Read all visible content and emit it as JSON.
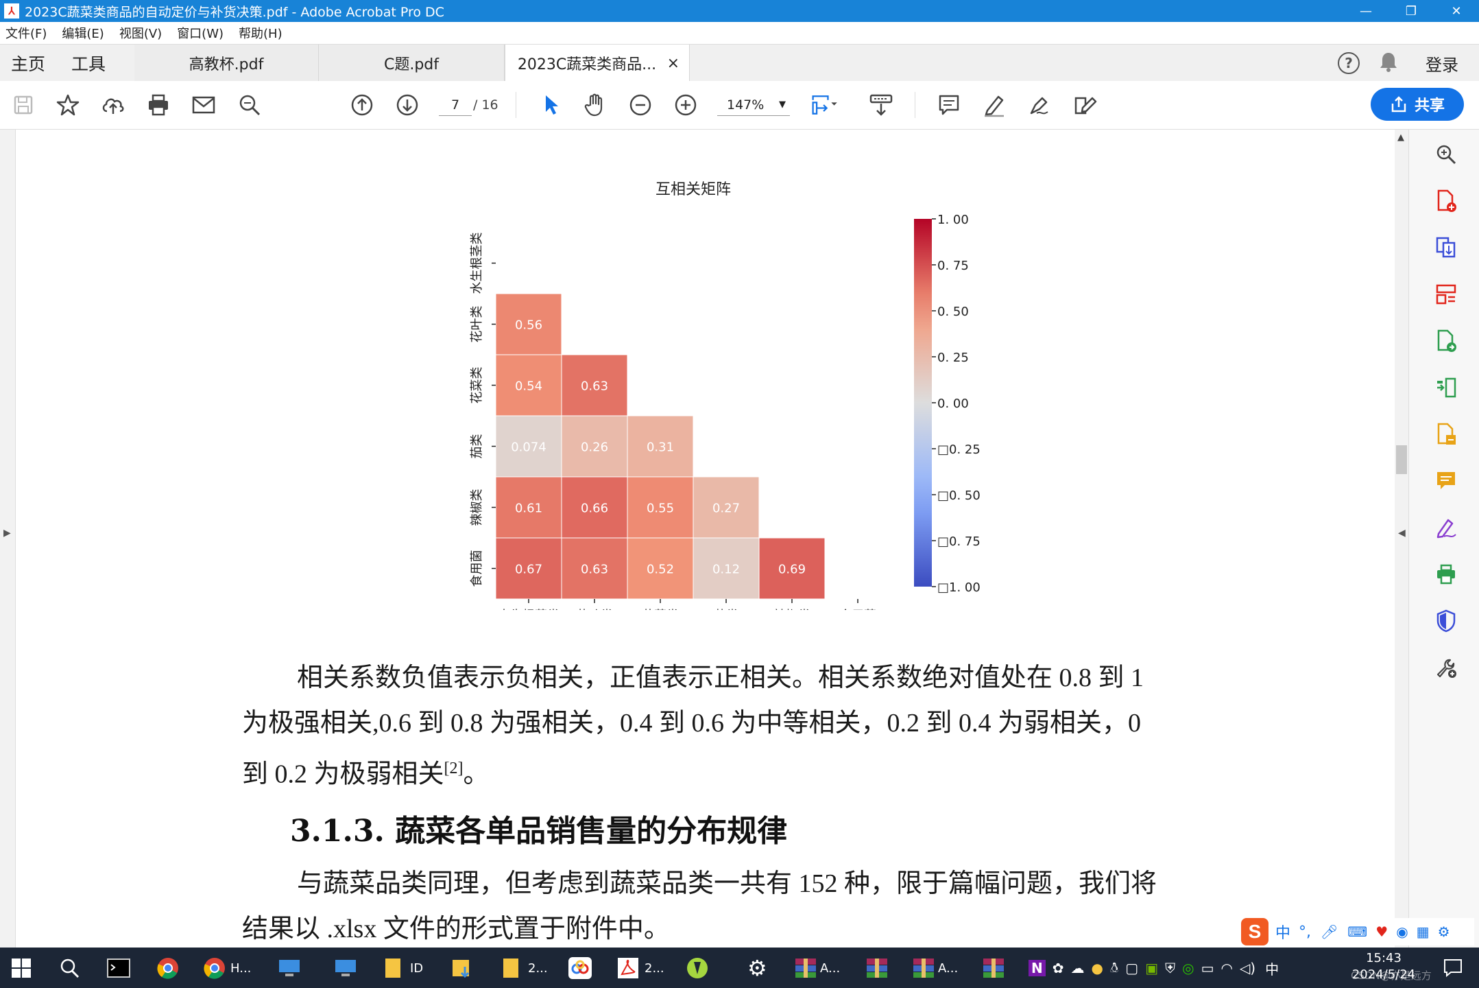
{
  "window": {
    "title": "2023C蔬菜类商品的自动定价与补货决策.pdf - Adobe Acrobat Pro DC",
    "minimize": "—",
    "restore": "❐",
    "close": "✕"
  },
  "menu": [
    "文件(F)",
    "编辑(E)",
    "视图(V)",
    "窗口(W)",
    "帮助(H)"
  ],
  "nav": {
    "home": "主页",
    "tools": "工具"
  },
  "tabs": [
    {
      "label": "高教杯.pdf"
    },
    {
      "label": "C题.pdf"
    },
    {
      "label": "2023C蔬菜类商品...",
      "close": "×"
    }
  ],
  "header_right": {
    "help": "?",
    "login": "登录"
  },
  "toolbar": {
    "page_current": "7",
    "page_total": "/ 16",
    "zoom": "147%",
    "share_label": "共享"
  },
  "chart_data": {
    "type": "heatmap",
    "title": "互相关矩阵",
    "rows": [
      "水生根茎类",
      "花叶类",
      "花菜类",
      "茄类",
      "辣椒类",
      "食用菌"
    ],
    "columns": [
      "水生根茎类",
      "花叶类",
      "花菜类",
      "茄类",
      "辣椒类",
      "食用菌"
    ],
    "mask": "upper-triangle-including-diagonal",
    "cells": [
      {
        "row": 1,
        "col": 0,
        "value": 0.56,
        "label": "0.56"
      },
      {
        "row": 2,
        "col": 0,
        "value": 0.54,
        "label": "0.54"
      },
      {
        "row": 2,
        "col": 1,
        "value": 0.63,
        "label": "0.63"
      },
      {
        "row": 3,
        "col": 0,
        "value": 0.074,
        "label": "0.074"
      },
      {
        "row": 3,
        "col": 1,
        "value": 0.26,
        "label": "0.26"
      },
      {
        "row": 3,
        "col": 2,
        "value": 0.31,
        "label": "0.31"
      },
      {
        "row": 4,
        "col": 0,
        "value": 0.61,
        "label": "0.61"
      },
      {
        "row": 4,
        "col": 1,
        "value": 0.66,
        "label": "0.66"
      },
      {
        "row": 4,
        "col": 2,
        "value": 0.55,
        "label": "0.55"
      },
      {
        "row": 4,
        "col": 3,
        "value": 0.27,
        "label": "0.27"
      },
      {
        "row": 5,
        "col": 0,
        "value": 0.67,
        "label": "0.67"
      },
      {
        "row": 5,
        "col": 1,
        "value": 0.63,
        "label": "0.63"
      },
      {
        "row": 5,
        "col": 2,
        "value": 0.52,
        "label": "0.52"
      },
      {
        "row": 5,
        "col": 3,
        "value": 0.12,
        "label": "0.12"
      },
      {
        "row": 5,
        "col": 4,
        "value": 0.69,
        "label": "0.69"
      }
    ],
    "colorbar": {
      "range": [
        -1.0,
        1.0
      ],
      "colormap": "coolwarm",
      "ticks": [
        1.0,
        0.75,
        0.5,
        0.25,
        0.0,
        -0.25,
        -0.5,
        -0.75,
        -1.0
      ],
      "tick_labels": [
        "1. 00",
        "0. 75",
        "0. 50",
        "0. 25",
        "0. 00",
        "□0. 25",
        "□0. 50",
        "□0. 75",
        "□1. 00"
      ]
    }
  },
  "content": {
    "para1": [
      "相关系数负值表示负相关，正值表示正相关。相关系数绝对值处在 0.8 到 1",
      "为极强相关,0.6 到 0.8 为强相关，0.4 到 0.6  为中等相关，0.2 到 0.4 为弱相关，0",
      "到 0.2 为极弱相关"
    ],
    "para1_ref": "[2]",
    "para1_end": "。",
    "heading": "3.1.3.  蔬菜各单品销售量的分布规律",
    "para2": [
      "与蔬菜品类同理，但考虑到蔬菜品类一共有 152 种，限于篇幅问题，我们将",
      "结果以  .xlsx 文件的形式置于附件中。"
    ]
  },
  "taskbar": {
    "items": [
      "H...",
      "ID",
      "2...",
      "2...",
      "A...",
      "A..."
    ],
    "ime": "中",
    "time": "15:43",
    "date": "2024/5/24",
    "watermark": "CSDN@亦是远方"
  },
  "colors": {
    "titlebar": "#1883d7",
    "accent": "#1473e6",
    "taskbar": "#1c2636"
  }
}
